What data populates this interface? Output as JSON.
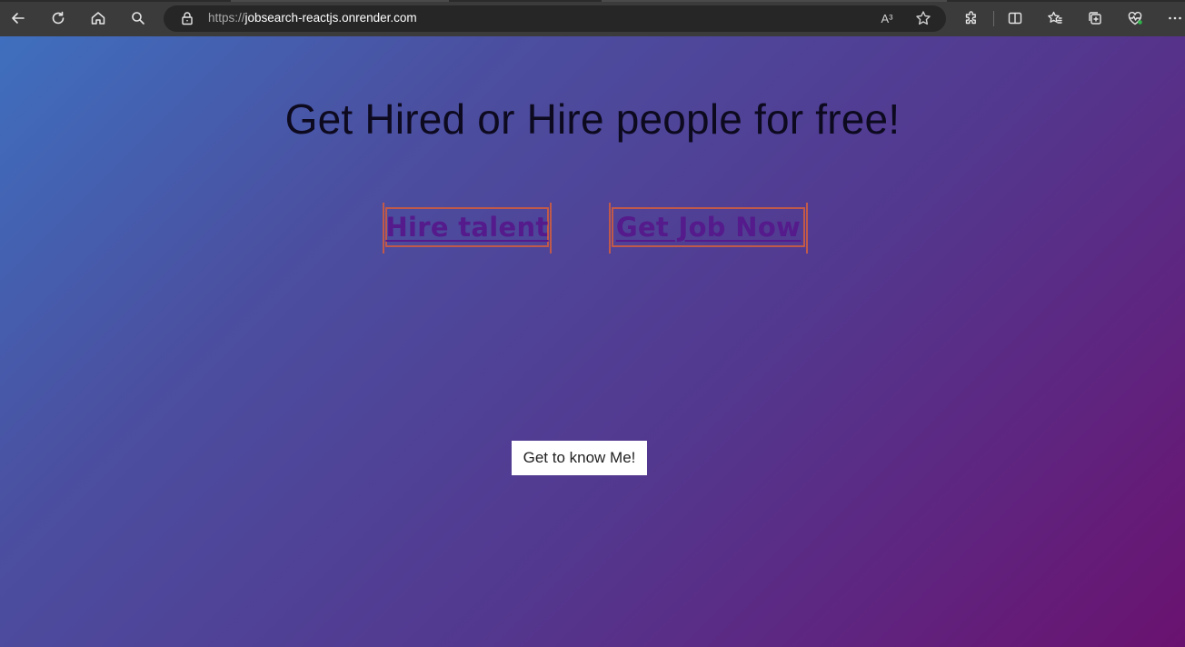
{
  "browser": {
    "url_scheme": "https://",
    "url_host": "jobsearch-reactjs.onrender.com",
    "toolbar_icons": [
      "back-icon",
      "refresh-icon",
      "home-icon",
      "search-icon",
      "lock-icon",
      "read-aloud-icon",
      "favorite-star-icon",
      "extensions-icon",
      "split-screen-icon",
      "favorites-icon",
      "collections-icon",
      "browser-essentials-icon",
      "more-icon"
    ],
    "read_aloud_glyph": "A³"
  },
  "page": {
    "headline": "Get Hired or Hire people for free!",
    "hire_label": "Hire talent",
    "job_label": "Get Job Now",
    "about_button": "Get to know Me!"
  },
  "colors": {
    "gradient_start": "#3f6fbe",
    "gradient_end": "#6a1270",
    "cta_border": "#c0594a",
    "link_color": "#551a8b",
    "browser_chrome": "#3b3b3b"
  }
}
